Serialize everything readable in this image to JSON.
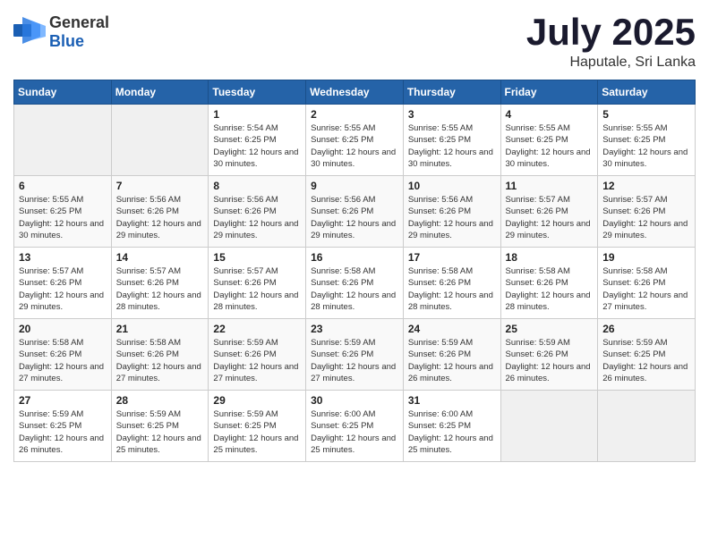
{
  "header": {
    "logo_general": "General",
    "logo_blue": "Blue",
    "month": "July 2025",
    "location": "Haputale, Sri Lanka"
  },
  "days_of_week": [
    "Sunday",
    "Monday",
    "Tuesday",
    "Wednesday",
    "Thursday",
    "Friday",
    "Saturday"
  ],
  "weeks": [
    [
      {
        "day": "",
        "info": ""
      },
      {
        "day": "",
        "info": ""
      },
      {
        "day": "1",
        "info": "Sunrise: 5:54 AM\nSunset: 6:25 PM\nDaylight: 12 hours and 30 minutes."
      },
      {
        "day": "2",
        "info": "Sunrise: 5:55 AM\nSunset: 6:25 PM\nDaylight: 12 hours and 30 minutes."
      },
      {
        "day": "3",
        "info": "Sunrise: 5:55 AM\nSunset: 6:25 PM\nDaylight: 12 hours and 30 minutes."
      },
      {
        "day": "4",
        "info": "Sunrise: 5:55 AM\nSunset: 6:25 PM\nDaylight: 12 hours and 30 minutes."
      },
      {
        "day": "5",
        "info": "Sunrise: 5:55 AM\nSunset: 6:25 PM\nDaylight: 12 hours and 30 minutes."
      }
    ],
    [
      {
        "day": "6",
        "info": "Sunrise: 5:55 AM\nSunset: 6:25 PM\nDaylight: 12 hours and 30 minutes."
      },
      {
        "day": "7",
        "info": "Sunrise: 5:56 AM\nSunset: 6:26 PM\nDaylight: 12 hours and 29 minutes."
      },
      {
        "day": "8",
        "info": "Sunrise: 5:56 AM\nSunset: 6:26 PM\nDaylight: 12 hours and 29 minutes."
      },
      {
        "day": "9",
        "info": "Sunrise: 5:56 AM\nSunset: 6:26 PM\nDaylight: 12 hours and 29 minutes."
      },
      {
        "day": "10",
        "info": "Sunrise: 5:56 AM\nSunset: 6:26 PM\nDaylight: 12 hours and 29 minutes."
      },
      {
        "day": "11",
        "info": "Sunrise: 5:57 AM\nSunset: 6:26 PM\nDaylight: 12 hours and 29 minutes."
      },
      {
        "day": "12",
        "info": "Sunrise: 5:57 AM\nSunset: 6:26 PM\nDaylight: 12 hours and 29 minutes."
      }
    ],
    [
      {
        "day": "13",
        "info": "Sunrise: 5:57 AM\nSunset: 6:26 PM\nDaylight: 12 hours and 29 minutes."
      },
      {
        "day": "14",
        "info": "Sunrise: 5:57 AM\nSunset: 6:26 PM\nDaylight: 12 hours and 28 minutes."
      },
      {
        "day": "15",
        "info": "Sunrise: 5:57 AM\nSunset: 6:26 PM\nDaylight: 12 hours and 28 minutes."
      },
      {
        "day": "16",
        "info": "Sunrise: 5:58 AM\nSunset: 6:26 PM\nDaylight: 12 hours and 28 minutes."
      },
      {
        "day": "17",
        "info": "Sunrise: 5:58 AM\nSunset: 6:26 PM\nDaylight: 12 hours and 28 minutes."
      },
      {
        "day": "18",
        "info": "Sunrise: 5:58 AM\nSunset: 6:26 PM\nDaylight: 12 hours and 28 minutes."
      },
      {
        "day": "19",
        "info": "Sunrise: 5:58 AM\nSunset: 6:26 PM\nDaylight: 12 hours and 27 minutes."
      }
    ],
    [
      {
        "day": "20",
        "info": "Sunrise: 5:58 AM\nSunset: 6:26 PM\nDaylight: 12 hours and 27 minutes."
      },
      {
        "day": "21",
        "info": "Sunrise: 5:58 AM\nSunset: 6:26 PM\nDaylight: 12 hours and 27 minutes."
      },
      {
        "day": "22",
        "info": "Sunrise: 5:59 AM\nSunset: 6:26 PM\nDaylight: 12 hours and 27 minutes."
      },
      {
        "day": "23",
        "info": "Sunrise: 5:59 AM\nSunset: 6:26 PM\nDaylight: 12 hours and 27 minutes."
      },
      {
        "day": "24",
        "info": "Sunrise: 5:59 AM\nSunset: 6:26 PM\nDaylight: 12 hours and 26 minutes."
      },
      {
        "day": "25",
        "info": "Sunrise: 5:59 AM\nSunset: 6:26 PM\nDaylight: 12 hours and 26 minutes."
      },
      {
        "day": "26",
        "info": "Sunrise: 5:59 AM\nSunset: 6:25 PM\nDaylight: 12 hours and 26 minutes."
      }
    ],
    [
      {
        "day": "27",
        "info": "Sunrise: 5:59 AM\nSunset: 6:25 PM\nDaylight: 12 hours and 26 minutes."
      },
      {
        "day": "28",
        "info": "Sunrise: 5:59 AM\nSunset: 6:25 PM\nDaylight: 12 hours and 25 minutes."
      },
      {
        "day": "29",
        "info": "Sunrise: 5:59 AM\nSunset: 6:25 PM\nDaylight: 12 hours and 25 minutes."
      },
      {
        "day": "30",
        "info": "Sunrise: 6:00 AM\nSunset: 6:25 PM\nDaylight: 12 hours and 25 minutes."
      },
      {
        "day": "31",
        "info": "Sunrise: 6:00 AM\nSunset: 6:25 PM\nDaylight: 12 hours and 25 minutes."
      },
      {
        "day": "",
        "info": ""
      },
      {
        "day": "",
        "info": ""
      }
    ]
  ]
}
